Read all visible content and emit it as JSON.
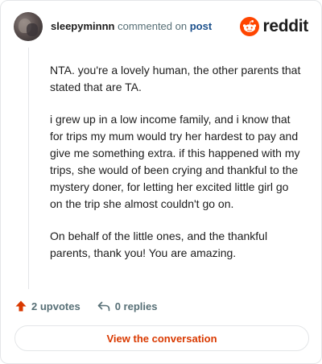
{
  "header": {
    "username": "sleepyminnn",
    "action_text": "commented on",
    "target_link": "post",
    "brand_name": "reddit"
  },
  "comment": {
    "paragraphs": [
      "NTA. you're a lovely human, the other parents that stated that are TA.",
      "i grew up in a low income family, and i know that for trips my mum would try her hardest to pay and give me something extra. if this happened with my trips, she would of been crying and thankful to the mystery doner, for letting her excited little girl go on the trip she almost couldn't go on.",
      "On behalf of the little ones, and the thankful parents, thank you! You are amazing."
    ]
  },
  "actions": {
    "upvotes_label": "2 upvotes",
    "replies_label": "0 replies"
  },
  "cta": {
    "label": "View the conversation"
  },
  "colors": {
    "brand_orange": "#ff4500",
    "upvote_arrow": "#d93900",
    "link_blue": "#1a4f8b",
    "muted_text": "#576f76",
    "cta_text": "#d93900"
  },
  "icons": {
    "brand": "reddit-snoo-icon",
    "upvote": "upvote-arrow-icon",
    "reply": "reply-arrow-icon"
  }
}
